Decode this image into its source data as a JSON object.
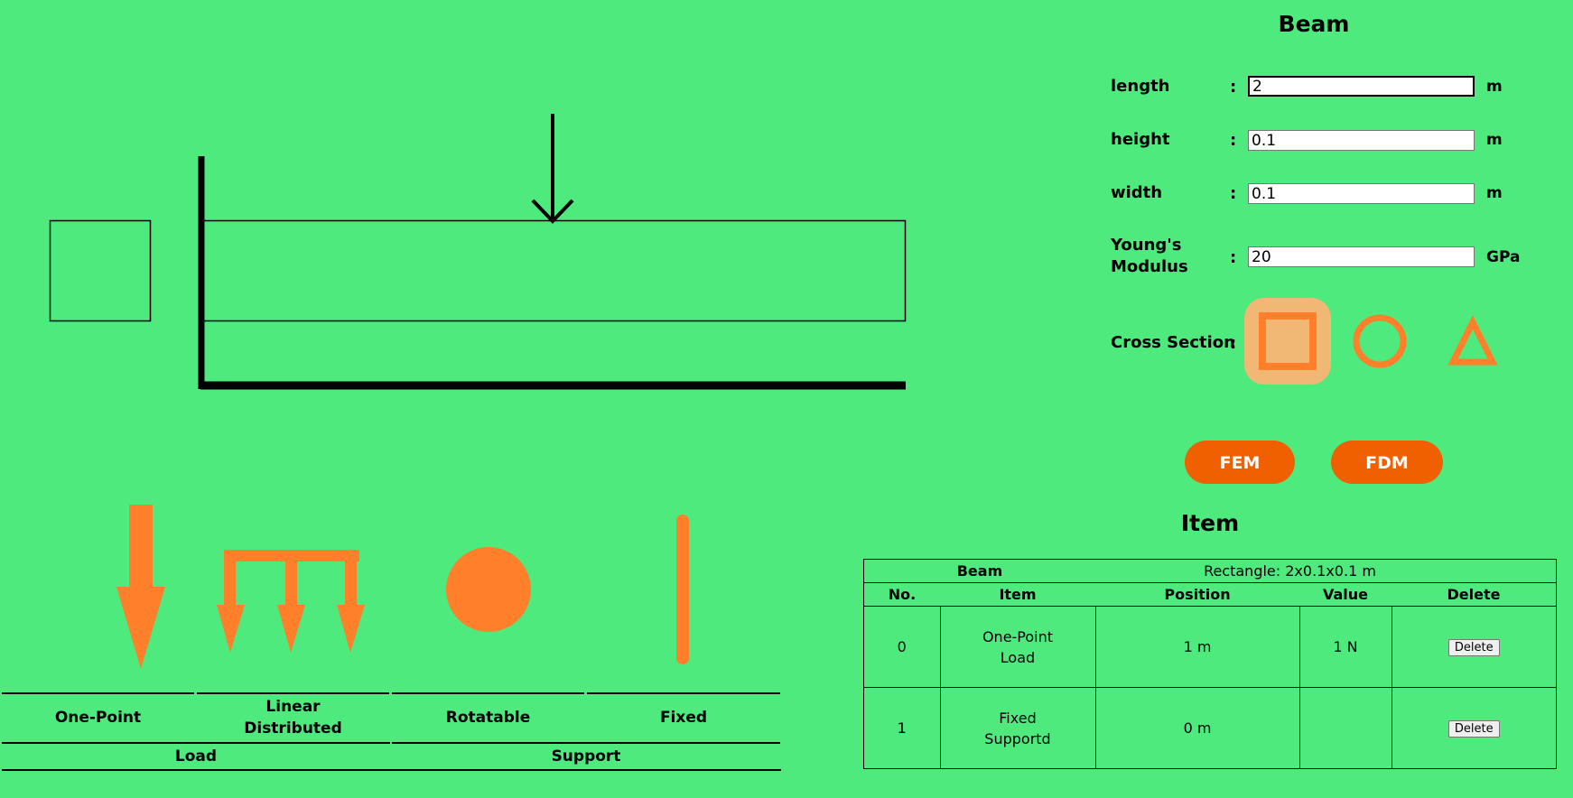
{
  "beam_form": {
    "title": "Beam",
    "fields": [
      {
        "label": "length",
        "value": "2",
        "unit": "m"
      },
      {
        "label": "height",
        "value": "0.1",
        "unit": "m"
      },
      {
        "label": "width",
        "value": "0.1",
        "unit": "m"
      },
      {
        "label_line1": "Young's",
        "label_line2": "Modulus",
        "value": "20",
        "unit": "GPa"
      }
    ],
    "colon": ":",
    "cross_section_label": "Cross Section",
    "cross_section_options": [
      "square-icon",
      "circle-icon",
      "triangle-icon"
    ],
    "cross_section_selected": "square-icon",
    "fem_label": "FEM",
    "fdm_label": "FDM"
  },
  "palette": {
    "items": [
      "One-Point",
      "Linear",
      "Distributed",
      "Rotatable",
      "Fixed"
    ],
    "groups": [
      "Load",
      "Support"
    ]
  },
  "item_section": {
    "title": "Item",
    "beam_row": {
      "label": "Beam",
      "value": "Rectangle: 2x0.1x0.1 m"
    },
    "headers": [
      "No.",
      "Item",
      "Position",
      "Value",
      "Delete"
    ],
    "rows": [
      {
        "no": "0",
        "item_line1": "One-Point",
        "item_line2": "Load",
        "position": "1 m",
        "value": "1 N",
        "delete": "Delete"
      },
      {
        "no": "1",
        "item_line1": "Fixed",
        "item_line2": "Supportd",
        "position": "0 m",
        "value": "",
        "delete": "Delete"
      }
    ]
  },
  "colors": {
    "background": "#4eea7e",
    "accent": "#ff7f2a",
    "button": "#f05f00",
    "selected_bg": "#f0b775"
  }
}
